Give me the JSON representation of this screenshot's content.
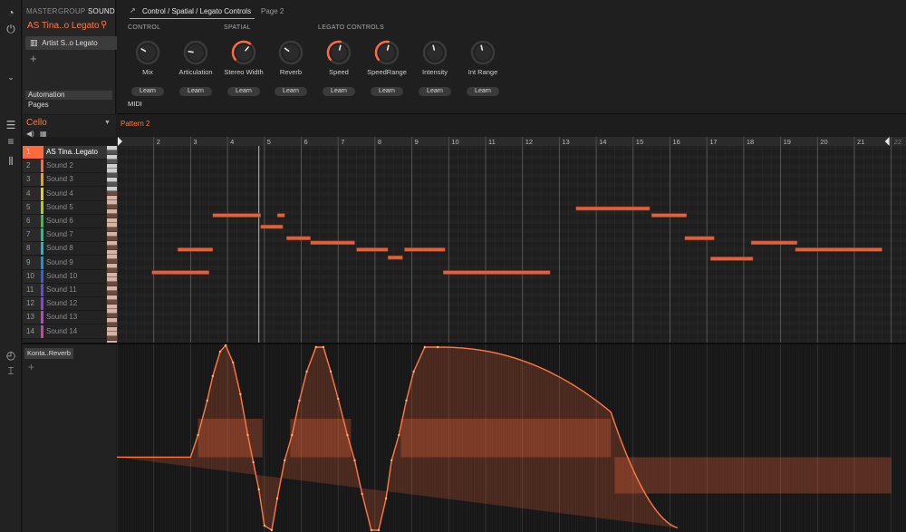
{
  "levels": {
    "master": "MASTER",
    "group": "GROUP",
    "sound": "SOUND"
  },
  "sound_name": "AS Tina..o Legato",
  "plugin": "Artist S..o Legato",
  "nav": {
    "automation": "Automation",
    "pages": "Pages"
  },
  "tabs": {
    "main": "Control / Spatial / Legato Controls",
    "page2": "Page 2"
  },
  "groups": {
    "control": "CONTROL",
    "spatial": "SPATIAL",
    "legato": "LEGATO CONTROLS"
  },
  "knobs": [
    {
      "label": "Mix",
      "value": 0.28,
      "learn": "Learn"
    },
    {
      "label": "Articulation",
      "value": 0.2,
      "learn": "Learn"
    },
    {
      "label": "Stereo Width",
      "value": 0.65,
      "learn": "Learn"
    },
    {
      "label": "Reverb",
      "value": 0.3,
      "learn": "Learn"
    },
    {
      "label": "Speed",
      "value": 0.55,
      "learn": "Learn"
    },
    {
      "label": "SpeedRange",
      "value": 0.55,
      "learn": "Learn"
    },
    {
      "label": "Intensity",
      "value": 0.45,
      "learn": "Learn"
    },
    {
      "label": "Int Range",
      "value": 0.45,
      "learn": "Learn"
    }
  ],
  "midi_label": "MIDI",
  "group_name": "Cello",
  "pattern_name": "Pattern 2",
  "bars": [
    "2",
    "3",
    "4",
    "5",
    "6",
    "7",
    "8",
    "9",
    "10",
    "11",
    "12",
    "13",
    "14",
    "15",
    "16",
    "17",
    "18",
    "19",
    "20",
    "21",
    "22"
  ],
  "sounds": [
    {
      "num": "1",
      "name": "AS Tina..Legato",
      "color": "#ff6a3d"
    },
    {
      "num": "2",
      "name": "Sound 2",
      "color": "#ff6a3d"
    },
    {
      "num": "3",
      "name": "Sound 3",
      "color": "#f0a020"
    },
    {
      "num": "4",
      "name": "Sound 4",
      "color": "#e8d020"
    },
    {
      "num": "5",
      "name": "Sound 5",
      "color": "#a8d020"
    },
    {
      "num": "6",
      "name": "Sound 6",
      "color": "#3cc040"
    },
    {
      "num": "7",
      "name": "Sound 7",
      "color": "#20c090"
    },
    {
      "num": "8",
      "name": "Sound 8",
      "color": "#20b8c8"
    },
    {
      "num": "9",
      "name": "Sound 9",
      "color": "#2090e0"
    },
    {
      "num": "10",
      "name": "Sound 10",
      "color": "#3060e8"
    },
    {
      "num": "11",
      "name": "Sound 11",
      "color": "#6048e0"
    },
    {
      "num": "12",
      "name": "Sound 12",
      "color": "#9040e0"
    },
    {
      "num": "13",
      "name": "Sound 13",
      "color": "#c040d0"
    },
    {
      "num": "14",
      "name": "Sound 14",
      "color": "#d040a0"
    }
  ],
  "notes": [
    {
      "start": 1.95,
      "len": 1.55,
      "row": 11
    },
    {
      "start": 2.65,
      "len": 0.95,
      "row": 9
    },
    {
      "start": 3.6,
      "len": 1.3,
      "row": 6
    },
    {
      "start": 4.9,
      "len": 0.6,
      "row": 7
    },
    {
      "start": 5.35,
      "len": 0.2,
      "row": 6
    },
    {
      "start": 5.6,
      "len": 0.65,
      "row": 8
    },
    {
      "start": 6.25,
      "len": 1.2,
      "row": 8.4
    },
    {
      "start": 7.5,
      "len": 0.85,
      "row": 9
    },
    {
      "start": 8.35,
      "len": 0.4,
      "row": 9.7
    },
    {
      "start": 8.8,
      "len": 1.1,
      "row": 9
    },
    {
      "start": 9.85,
      "len": 2.9,
      "row": 11
    },
    {
      "start": 13.45,
      "len": 2.0,
      "row": 5.4
    },
    {
      "start": 15.5,
      "len": 0.95,
      "row": 6
    },
    {
      "start": 16.4,
      "len": 0.8,
      "row": 8
    },
    {
      "start": 17.1,
      "len": 1.15,
      "row": 9.8
    },
    {
      "start": 18.2,
      "len": 1.25,
      "row": 8.4
    },
    {
      "start": 19.4,
      "len": 2.35,
      "row": 9
    }
  ],
  "automation_target": "Konta..Reverb",
  "y_ticks": [
    "1.00",
    "0.89",
    "0.76",
    "0.64",
    "0.51",
    "0.39",
    "0.26",
    "0.14",
    "0.01"
  ],
  "colors": {
    "accent": "#ff6a3d",
    "background": "#1b1b1b"
  }
}
